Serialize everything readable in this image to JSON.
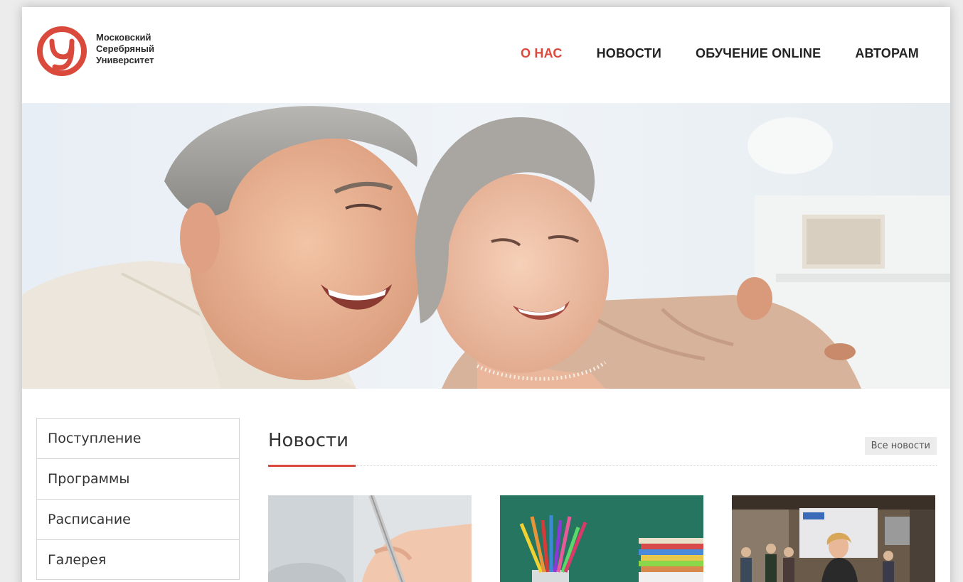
{
  "header": {
    "logo_lines": [
      "Московский",
      "Серебряный",
      "Университет"
    ],
    "nav": [
      {
        "label": "О НАС",
        "active": true
      },
      {
        "label": "НОВОСТИ",
        "active": false
      },
      {
        "label": "ОБУЧЕНИЕ ONLINE",
        "active": false
      },
      {
        "label": "АВТОРАМ",
        "active": false
      }
    ]
  },
  "sidebar": {
    "items": [
      {
        "label": "Поступление"
      },
      {
        "label": "Программы"
      },
      {
        "label": "Расписание"
      },
      {
        "label": "Галерея"
      }
    ]
  },
  "news": {
    "title": "Новости",
    "all_link": "Все новости",
    "cards": [
      {
        "image": "hand-writing-with-pen"
      },
      {
        "image": "colored-pencils-and-notebooks"
      },
      {
        "image": "speaker-at-exhibition"
      }
    ]
  },
  "colors": {
    "accent": "#d94a3d",
    "text": "#222222",
    "border": "#d4d4d4"
  },
  "icons": [
    "university-logo-icon"
  ]
}
